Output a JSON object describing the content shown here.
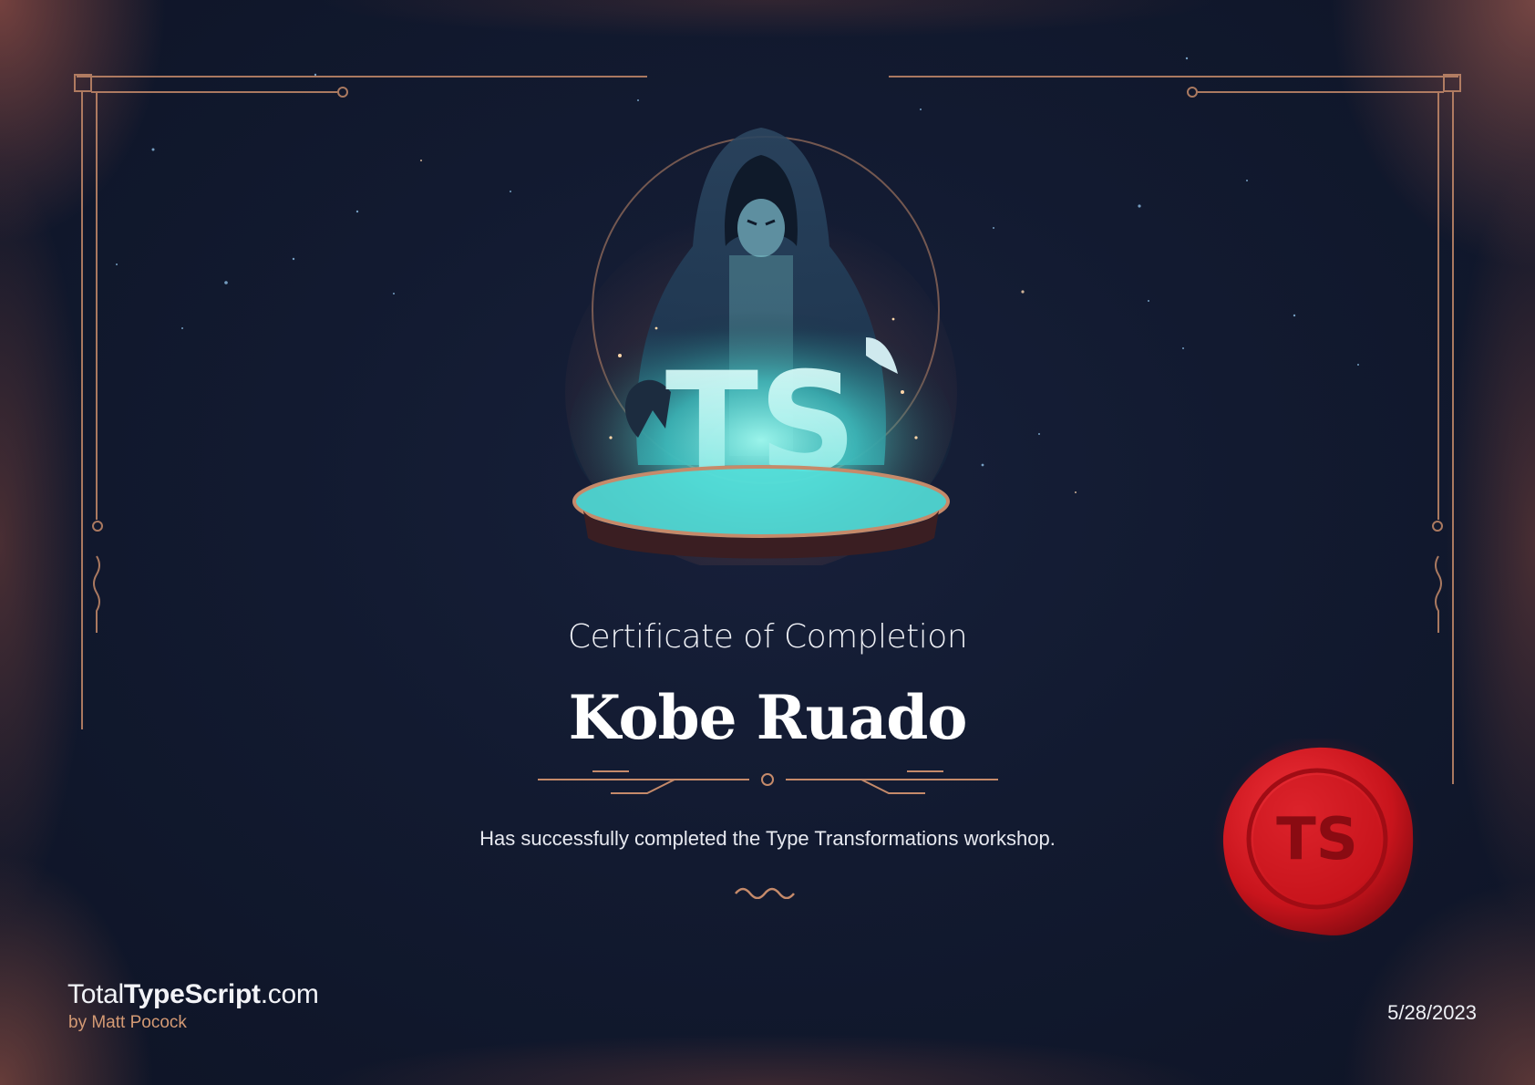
{
  "certificate": {
    "heading": "Certificate of Completion",
    "recipient": "Kobe Ruado",
    "description": "Has successfully completed the Type Transformations workshop.",
    "date": "5/28/2023"
  },
  "hero": {
    "badge_text": "TS"
  },
  "seal": {
    "text": "TS"
  },
  "brand": {
    "prefix": "Total",
    "bold": "TypeScript",
    "suffix": ".com",
    "byline": "by Matt Pocock"
  },
  "colors": {
    "background": "#121a30",
    "frame": "#c58a6a",
    "glow": "#6fe6e0",
    "seal": "#c8141c",
    "byline": "#d49a74"
  },
  "icons": [
    "wizard-illustration",
    "wax-seal-icon",
    "ornament-divider-icon",
    "squiggle-icon"
  ]
}
